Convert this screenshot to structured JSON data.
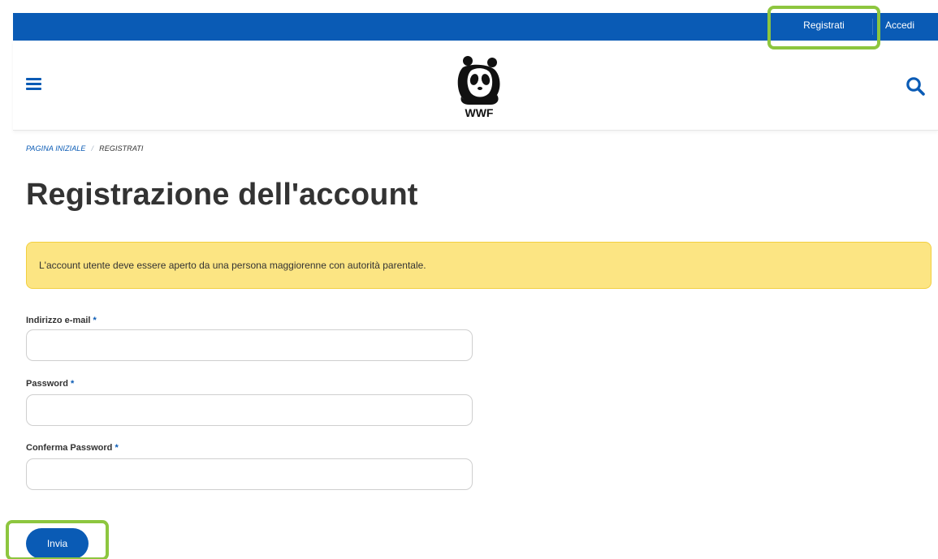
{
  "topbar": {
    "register_label": "Registrati",
    "login_label": "Accedi"
  },
  "header": {
    "menu_icon": "hamburger-menu-icon",
    "logo_text": "WWF",
    "search_icon": "search-icon"
  },
  "breadcrumb": {
    "home": "PAGINA INIZIALE",
    "separator": "/",
    "current": "REGISTRATI"
  },
  "page": {
    "title": "Registrazione dell'account"
  },
  "alert": {
    "text": "L'account utente deve essere aperto da una persona maggiorenne con autorità parentale."
  },
  "form": {
    "required_marker": "*",
    "email_label": "Indirizzo e-mail",
    "email_value": "",
    "password_label": "Password",
    "password_value": "",
    "confirm_label": "Conferma Password",
    "confirm_value": "",
    "submit_label": "Invia"
  },
  "colors": {
    "brand_blue": "#0a5bb5",
    "alert_yellow": "#fce583",
    "highlight_green": "#8dc63f"
  }
}
